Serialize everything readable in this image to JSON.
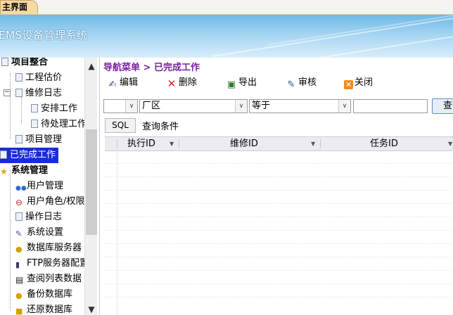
{
  "tab": {
    "label": "主界面"
  },
  "banner": {
    "title": "EMS设备管理系统"
  },
  "tree": {
    "items": [
      {
        "label": "项目整合",
        "bold": true
      },
      {
        "label": "工程估价"
      },
      {
        "label": "维修日志"
      },
      {
        "label": "安排工作"
      },
      {
        "label": "待处理工作"
      },
      {
        "label": "项目管理"
      },
      {
        "label": "已完成工作",
        "selected": true
      },
      {
        "label": "系统管理",
        "bold": true
      },
      {
        "label": "用户管理"
      },
      {
        "label": "用户角色/权限"
      },
      {
        "label": "操作日志"
      },
      {
        "label": "系统设置"
      },
      {
        "label": "数据库服务器"
      },
      {
        "label": "FTP服务器配置"
      },
      {
        "label": "查阅列表数据"
      },
      {
        "label": "备份数据库"
      },
      {
        "label": "还原数据库"
      }
    ],
    "expander_minus": "−",
    "scroll_up": "▲",
    "scroll_down": "▼"
  },
  "breadcrumb": {
    "text": "导航菜单 > 已完成工作"
  },
  "toolbar": {
    "edit": "编辑",
    "delete": "删除",
    "export": "导出",
    "audit": "审核",
    "close": "关闭"
  },
  "filter": {
    "first_value": "",
    "field_value": "厂区",
    "operator_value": "等于",
    "value_input": "",
    "query_button": "查"
  },
  "sql": {
    "button": "SQL",
    "label": "查询条件"
  },
  "grid": {
    "columns": [
      "执行ID",
      "维修ID",
      "任务ID"
    ],
    "rows": []
  },
  "colors": {
    "selected": "#1a2bd8",
    "breadcrumb": "#7a1fa0",
    "tab": "#f7d9a4"
  }
}
